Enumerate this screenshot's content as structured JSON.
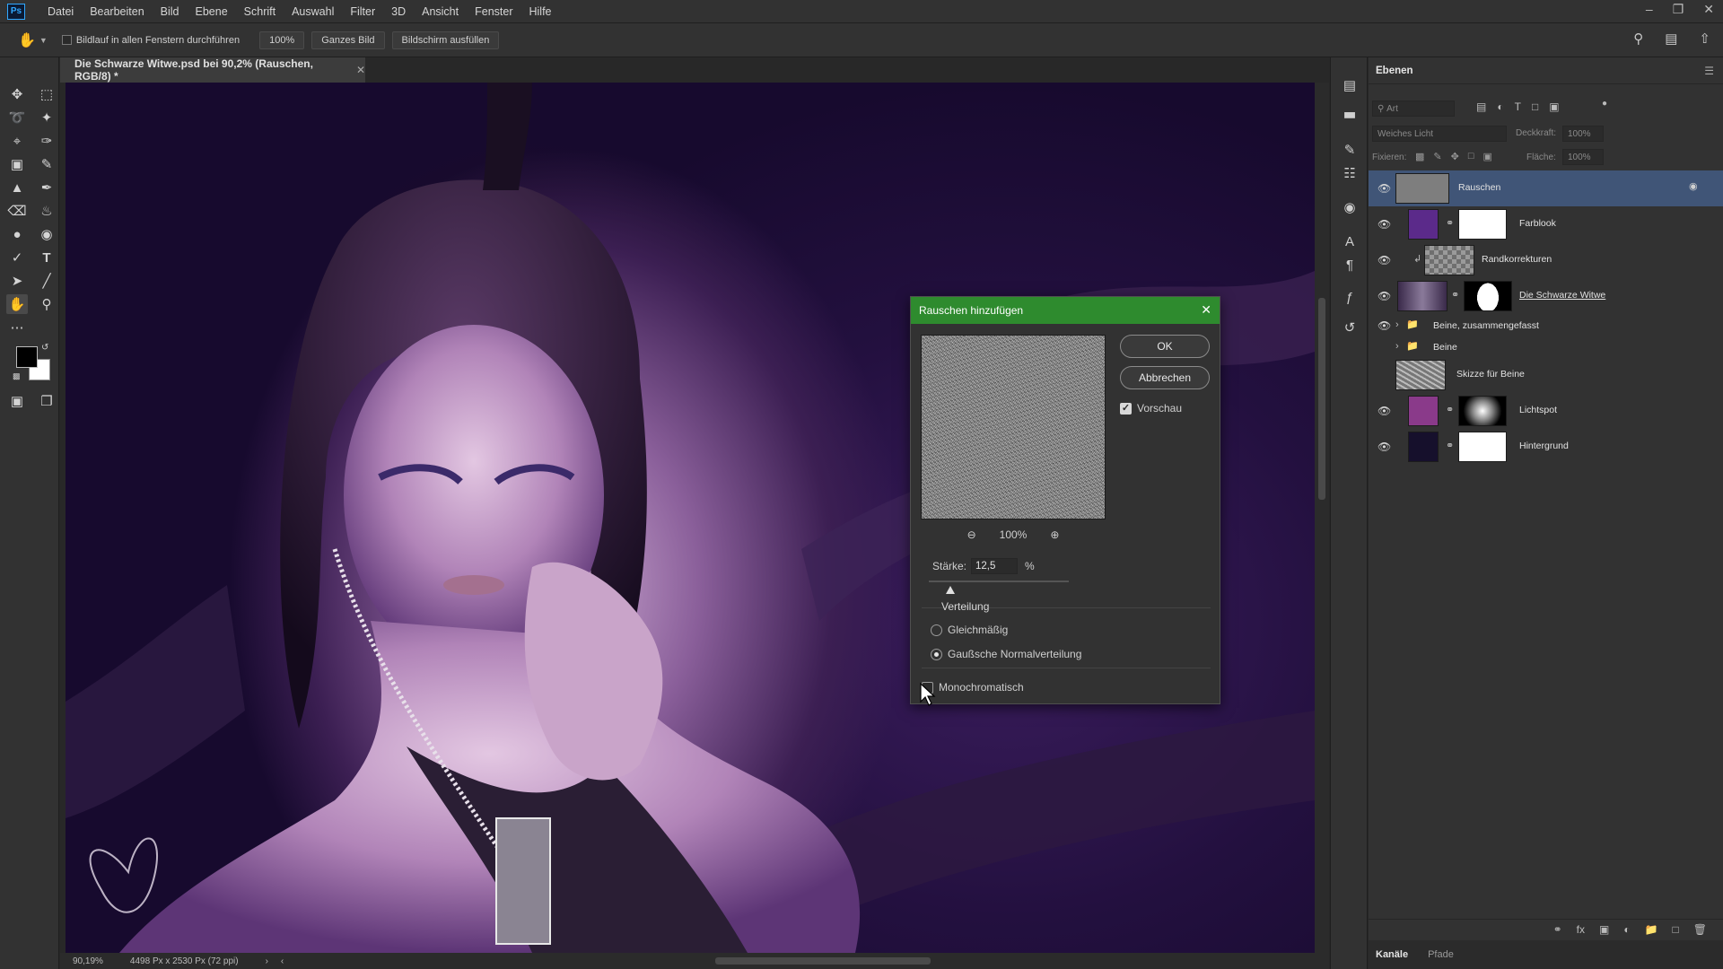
{
  "app": {
    "logo": "Ps"
  },
  "menu": [
    "Datei",
    "Bearbeiten",
    "Bild",
    "Ebene",
    "Schrift",
    "Auswahl",
    "Filter",
    "3D",
    "Ansicht",
    "Fenster",
    "Hilfe"
  ],
  "options": {
    "scroll_all_label": "Bildlauf in allen Fenstern durchführen",
    "zoom_btn": "100%",
    "fit_btn": "Ganzes Bild",
    "fill_btn": "Bildschirm ausfüllen"
  },
  "document": {
    "tab_title": "Die Schwarze Witwe.psd bei 90,2% (Rauschen, RGB/8) *",
    "zoom": "90,19%",
    "info": "4498 Px x 2530 Px (72 ppi)"
  },
  "dialog": {
    "title": "Rauschen hinzufügen",
    "ok": "OK",
    "cancel": "Abbrechen",
    "preview_label": "Vorschau",
    "preview_checked": true,
    "preview_zoom": "100%",
    "amount_label": "Stärke:",
    "amount_value": "12,5",
    "amount_unit": "%",
    "amount_fraction": 0.125,
    "distribution_label": "Verteilung",
    "dist_uniform": "Gleichmäßig",
    "dist_gaussian": "Gaußsche Normalverteilung",
    "selected_distribution": "Gaußsche Normalverteilung",
    "mono_label": "Monochromatisch",
    "mono_checked": false
  },
  "layers_panel": {
    "tab": "Ebenen",
    "search_placeholder": "Art",
    "blend_mode": "Weiches Licht",
    "opacity_label": "Deckkraft:",
    "opacity_value": "100%",
    "lock_label": "Fixieren:",
    "fill_label": "Fläche:",
    "fill_value": "100%",
    "layers": [
      {
        "name": "Rauschen",
        "visible": true,
        "selected": true
      },
      {
        "name": "Farblook",
        "visible": true
      },
      {
        "name": "Randkorrekturen",
        "visible": true
      },
      {
        "name": "Die Schwarze Witwe",
        "visible": true
      },
      {
        "name": "Beine, zusammengefasst",
        "visible": true,
        "group": true
      },
      {
        "name": "Beine",
        "visible": false,
        "group": true
      },
      {
        "name": "Skizze für Beine",
        "visible": false
      },
      {
        "name": "Lichtspot",
        "visible": true
      },
      {
        "name": "Hintergrund",
        "visible": true
      }
    ],
    "bottom_tabs": [
      "Kanäle",
      "Pfade"
    ]
  },
  "colors": {
    "dialog_title_bg": "#2e8b2e",
    "selected_layer_bg": "#405577",
    "foreground_swatch": "#000000",
    "background_swatch": "#ffffff"
  }
}
